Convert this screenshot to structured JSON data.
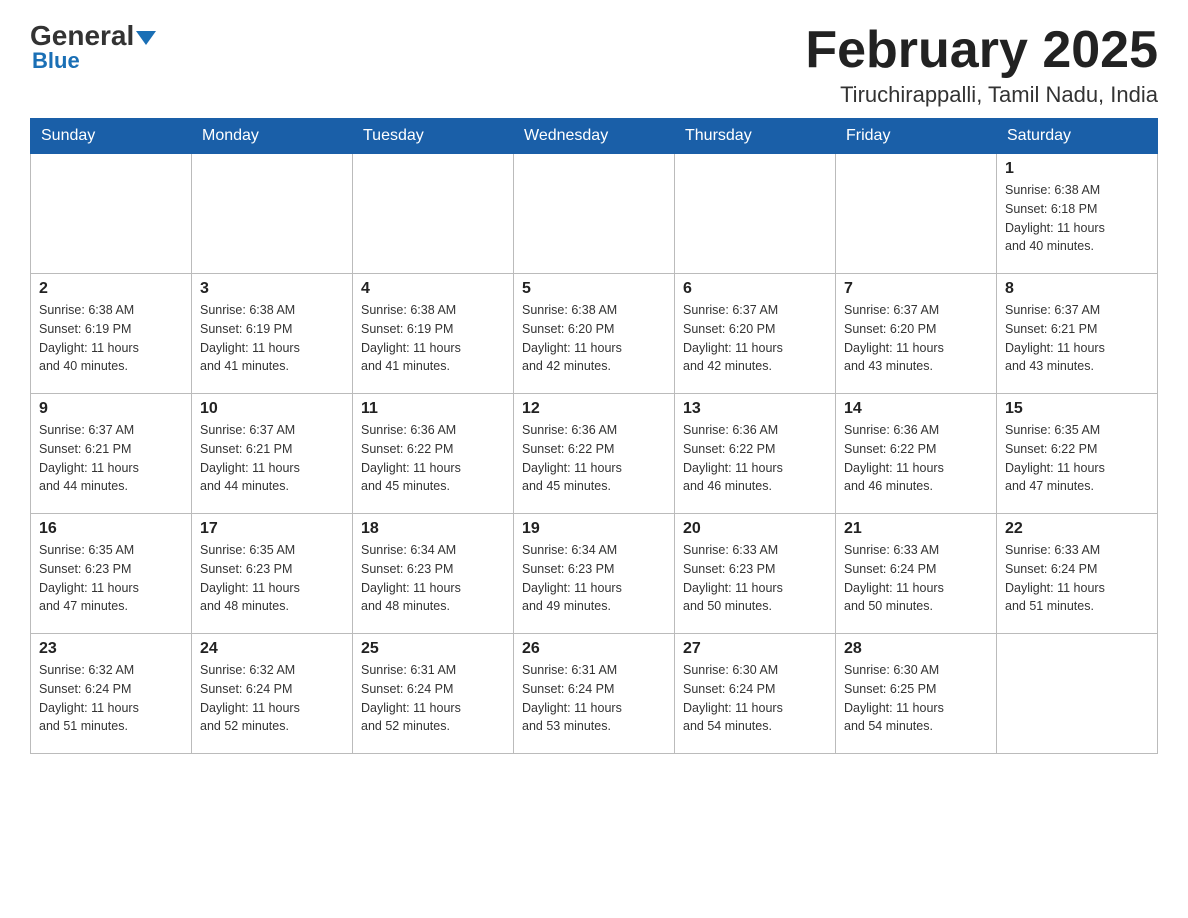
{
  "logo": {
    "general": "General",
    "arrow": "▼",
    "blue": "Blue"
  },
  "header": {
    "month_title": "February 2025",
    "location": "Tiruchirappalli, Tamil Nadu, India"
  },
  "days_of_week": [
    "Sunday",
    "Monday",
    "Tuesday",
    "Wednesday",
    "Thursday",
    "Friday",
    "Saturday"
  ],
  "weeks": [
    [
      {
        "day": "",
        "info": ""
      },
      {
        "day": "",
        "info": ""
      },
      {
        "day": "",
        "info": ""
      },
      {
        "day": "",
        "info": ""
      },
      {
        "day": "",
        "info": ""
      },
      {
        "day": "",
        "info": ""
      },
      {
        "day": "1",
        "info": "Sunrise: 6:38 AM\nSunset: 6:18 PM\nDaylight: 11 hours\nand 40 minutes."
      }
    ],
    [
      {
        "day": "2",
        "info": "Sunrise: 6:38 AM\nSunset: 6:19 PM\nDaylight: 11 hours\nand 40 minutes."
      },
      {
        "day": "3",
        "info": "Sunrise: 6:38 AM\nSunset: 6:19 PM\nDaylight: 11 hours\nand 41 minutes."
      },
      {
        "day": "4",
        "info": "Sunrise: 6:38 AM\nSunset: 6:19 PM\nDaylight: 11 hours\nand 41 minutes."
      },
      {
        "day": "5",
        "info": "Sunrise: 6:38 AM\nSunset: 6:20 PM\nDaylight: 11 hours\nand 42 minutes."
      },
      {
        "day": "6",
        "info": "Sunrise: 6:37 AM\nSunset: 6:20 PM\nDaylight: 11 hours\nand 42 minutes."
      },
      {
        "day": "7",
        "info": "Sunrise: 6:37 AM\nSunset: 6:20 PM\nDaylight: 11 hours\nand 43 minutes."
      },
      {
        "day": "8",
        "info": "Sunrise: 6:37 AM\nSunset: 6:21 PM\nDaylight: 11 hours\nand 43 minutes."
      }
    ],
    [
      {
        "day": "9",
        "info": "Sunrise: 6:37 AM\nSunset: 6:21 PM\nDaylight: 11 hours\nand 44 minutes."
      },
      {
        "day": "10",
        "info": "Sunrise: 6:37 AM\nSunset: 6:21 PM\nDaylight: 11 hours\nand 44 minutes."
      },
      {
        "day": "11",
        "info": "Sunrise: 6:36 AM\nSunset: 6:22 PM\nDaylight: 11 hours\nand 45 minutes."
      },
      {
        "day": "12",
        "info": "Sunrise: 6:36 AM\nSunset: 6:22 PM\nDaylight: 11 hours\nand 45 minutes."
      },
      {
        "day": "13",
        "info": "Sunrise: 6:36 AM\nSunset: 6:22 PM\nDaylight: 11 hours\nand 46 minutes."
      },
      {
        "day": "14",
        "info": "Sunrise: 6:36 AM\nSunset: 6:22 PM\nDaylight: 11 hours\nand 46 minutes."
      },
      {
        "day": "15",
        "info": "Sunrise: 6:35 AM\nSunset: 6:22 PM\nDaylight: 11 hours\nand 47 minutes."
      }
    ],
    [
      {
        "day": "16",
        "info": "Sunrise: 6:35 AM\nSunset: 6:23 PM\nDaylight: 11 hours\nand 47 minutes."
      },
      {
        "day": "17",
        "info": "Sunrise: 6:35 AM\nSunset: 6:23 PM\nDaylight: 11 hours\nand 48 minutes."
      },
      {
        "day": "18",
        "info": "Sunrise: 6:34 AM\nSunset: 6:23 PM\nDaylight: 11 hours\nand 48 minutes."
      },
      {
        "day": "19",
        "info": "Sunrise: 6:34 AM\nSunset: 6:23 PM\nDaylight: 11 hours\nand 49 minutes."
      },
      {
        "day": "20",
        "info": "Sunrise: 6:33 AM\nSunset: 6:23 PM\nDaylight: 11 hours\nand 50 minutes."
      },
      {
        "day": "21",
        "info": "Sunrise: 6:33 AM\nSunset: 6:24 PM\nDaylight: 11 hours\nand 50 minutes."
      },
      {
        "day": "22",
        "info": "Sunrise: 6:33 AM\nSunset: 6:24 PM\nDaylight: 11 hours\nand 51 minutes."
      }
    ],
    [
      {
        "day": "23",
        "info": "Sunrise: 6:32 AM\nSunset: 6:24 PM\nDaylight: 11 hours\nand 51 minutes."
      },
      {
        "day": "24",
        "info": "Sunrise: 6:32 AM\nSunset: 6:24 PM\nDaylight: 11 hours\nand 52 minutes."
      },
      {
        "day": "25",
        "info": "Sunrise: 6:31 AM\nSunset: 6:24 PM\nDaylight: 11 hours\nand 52 minutes."
      },
      {
        "day": "26",
        "info": "Sunrise: 6:31 AM\nSunset: 6:24 PM\nDaylight: 11 hours\nand 53 minutes."
      },
      {
        "day": "27",
        "info": "Sunrise: 6:30 AM\nSunset: 6:24 PM\nDaylight: 11 hours\nand 54 minutes."
      },
      {
        "day": "28",
        "info": "Sunrise: 6:30 AM\nSunset: 6:25 PM\nDaylight: 11 hours\nand 54 minutes."
      },
      {
        "day": "",
        "info": ""
      }
    ]
  ]
}
